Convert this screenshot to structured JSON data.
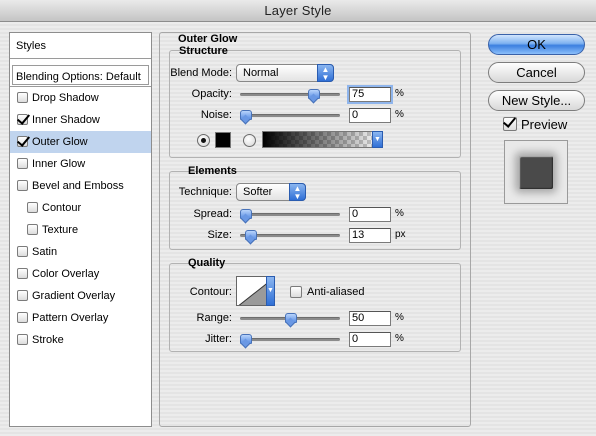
{
  "window": {
    "title": "Layer Style"
  },
  "styles_list": {
    "header": "Styles",
    "blending_options": "Blending Options: Default",
    "items": [
      {
        "label": "Drop Shadow",
        "checked": false,
        "selected": false,
        "sub": false
      },
      {
        "label": "Inner Shadow",
        "checked": true,
        "selected": false,
        "sub": false
      },
      {
        "label": "Outer Glow",
        "checked": true,
        "selected": true,
        "sub": false
      },
      {
        "label": "Inner Glow",
        "checked": false,
        "selected": false,
        "sub": false
      },
      {
        "label": "Bevel and Emboss",
        "checked": false,
        "selected": false,
        "sub": false
      },
      {
        "label": "Contour",
        "checked": false,
        "selected": false,
        "sub": true
      },
      {
        "label": "Texture",
        "checked": false,
        "selected": false,
        "sub": true
      },
      {
        "label": "Satin",
        "checked": false,
        "selected": false,
        "sub": false
      },
      {
        "label": "Color Overlay",
        "checked": false,
        "selected": false,
        "sub": false
      },
      {
        "label": "Gradient Overlay",
        "checked": false,
        "selected": false,
        "sub": false
      },
      {
        "label": "Pattern Overlay",
        "checked": false,
        "selected": false,
        "sub": false
      },
      {
        "label": "Stroke",
        "checked": false,
        "selected": false,
        "sub": false
      }
    ]
  },
  "panel": {
    "title": "Outer Glow",
    "structure": {
      "title": "Structure",
      "blend_mode_label": "Blend Mode:",
      "blend_mode_value": "Normal",
      "opacity_label": "Opacity:",
      "opacity_value": "75",
      "opacity_level": 0.75,
      "opacity_unit": "%",
      "noise_label": "Noise:",
      "noise_value": "0",
      "noise_level": 0,
      "noise_unit": "%",
      "color_selected": "solid",
      "glow_color": "#000000"
    },
    "elements": {
      "title": "Elements",
      "technique_label": "Technique:",
      "technique_value": "Softer",
      "spread_label": "Spread:",
      "spread_value": "0",
      "spread_level": 0,
      "spread_unit": "%",
      "size_label": "Size:",
      "size_value": "13",
      "size_level": 0.052,
      "size_unit": "px"
    },
    "quality": {
      "title": "Quality",
      "contour_label": "Contour:",
      "anti_aliased_label": "Anti-aliased",
      "anti_aliased_checked": false,
      "range_label": "Range:",
      "range_value": "50",
      "range_level": 0.5,
      "range_unit": "%",
      "jitter_label": "Jitter:",
      "jitter_value": "0",
      "jitter_level": 0,
      "jitter_unit": "%"
    }
  },
  "buttons": {
    "ok": "OK",
    "cancel": "Cancel",
    "new_style": "New Style...",
    "preview_label": "Preview",
    "preview_checked": true
  },
  "icons": {
    "select_arrows": "updown-arrows-icon",
    "dropdown": "triangle-down-icon"
  },
  "colors": {
    "selection": "#c0d4ee",
    "aqua_blue": "#3b7fe0"
  }
}
